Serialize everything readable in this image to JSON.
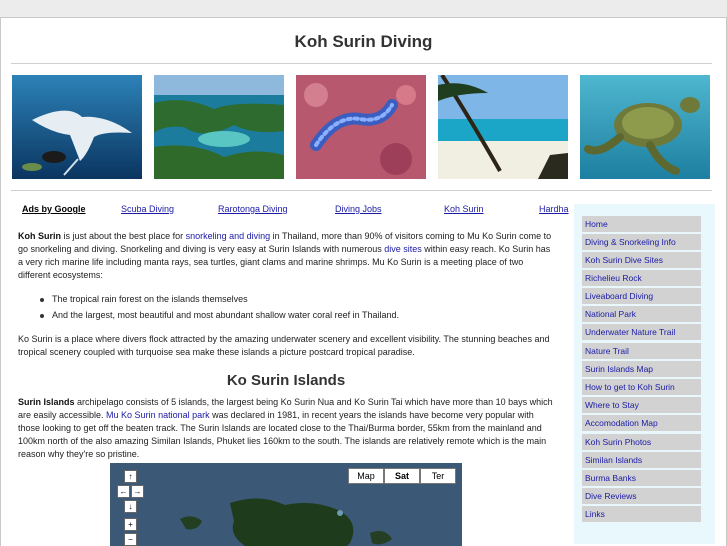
{
  "site": {
    "title": "Koh Surin Diving"
  },
  "photos": [
    {
      "icon": "manta-ray-photo"
    },
    {
      "icon": "island-aerial-photo"
    },
    {
      "icon": "nudibranch-photo"
    },
    {
      "icon": "beach-palm-photo"
    },
    {
      "icon": "sea-turtle-photo"
    }
  ],
  "ads": {
    "label": "Ads by Google",
    "links": [
      "Scuba Diving",
      "Rarotonga Diving",
      "Diving Jobs",
      "Koh Surin",
      "Hardha"
    ]
  },
  "content": {
    "intro": {
      "b1": "Koh Surin",
      "t1": " is just about the best place for ",
      "l1": "snorkeling and diving",
      "t2": " in Thailand, more than 90% of visitors coming to Mu Ko Surin come to go snorkeling and diving. Snorkeling and diving is very easy at Surin Islands with numerous ",
      "l2": "dive sites",
      "t3": " within easy reach. Ko Surin has a very rich marine life including manta rays, sea turtles, giant clams and marine shrimps. Mu Ko Surin is a meeting place of two different ecosystems:"
    },
    "bullets": [
      "The tropical rain forest on the islands themselves",
      "And the largest, most beautiful and most abundant shallow water coral reef in Thailand."
    ],
    "para2": "Ko Surin is a place where divers flock attracted by the amazing underwater scenery and excellent visibility. The stunning beaches and tropical scenery coupled with turquoise sea make these islands a picture postcard tropical paradise.",
    "section_title": "Ko Surin Islands",
    "para3": {
      "b1": "Surin Islands",
      "t1": " archipelago consists of 5 islands, the largest being Ko Surin Nua and Ko Surin Tai which have more than 10 bays which are easily accessible. ",
      "l1": "Mu Ko Surin national park",
      "t2": " was declared in 1981, in recent years the islands have become very popular with those looking to get off the beaten track. The Surin Islands are located close to the Thai/Burma border, 55km from the mainland and 100km north of the also amazing Similan Islands, Phuket lies 160km to the south. The islands are relatively remote which is the main reason why they're so pristine."
    }
  },
  "map": {
    "types": [
      "Map",
      "Sat",
      "Ter"
    ],
    "selected": "Sat",
    "nav": {
      "up": "↑",
      "left": "←",
      "right": "→",
      "down": "↓",
      "zoom_in": "+",
      "zoom_out": "−"
    }
  },
  "sidebar": {
    "items": [
      "Home",
      "Diving & Snorkeling Info",
      "Koh Surin Dive Sites",
      "Richelieu Rock",
      "Liveaboard Diving",
      "National Park",
      "Underwater Nature Trail",
      "Nature Trail",
      "Surin Islands Map",
      "How to get to Koh Surin",
      "Where to Stay",
      "Accomodation Map",
      "Koh Surin Photos",
      "Similan Islands",
      "Burma Banks",
      "Dive Reviews",
      "Links"
    ]
  }
}
